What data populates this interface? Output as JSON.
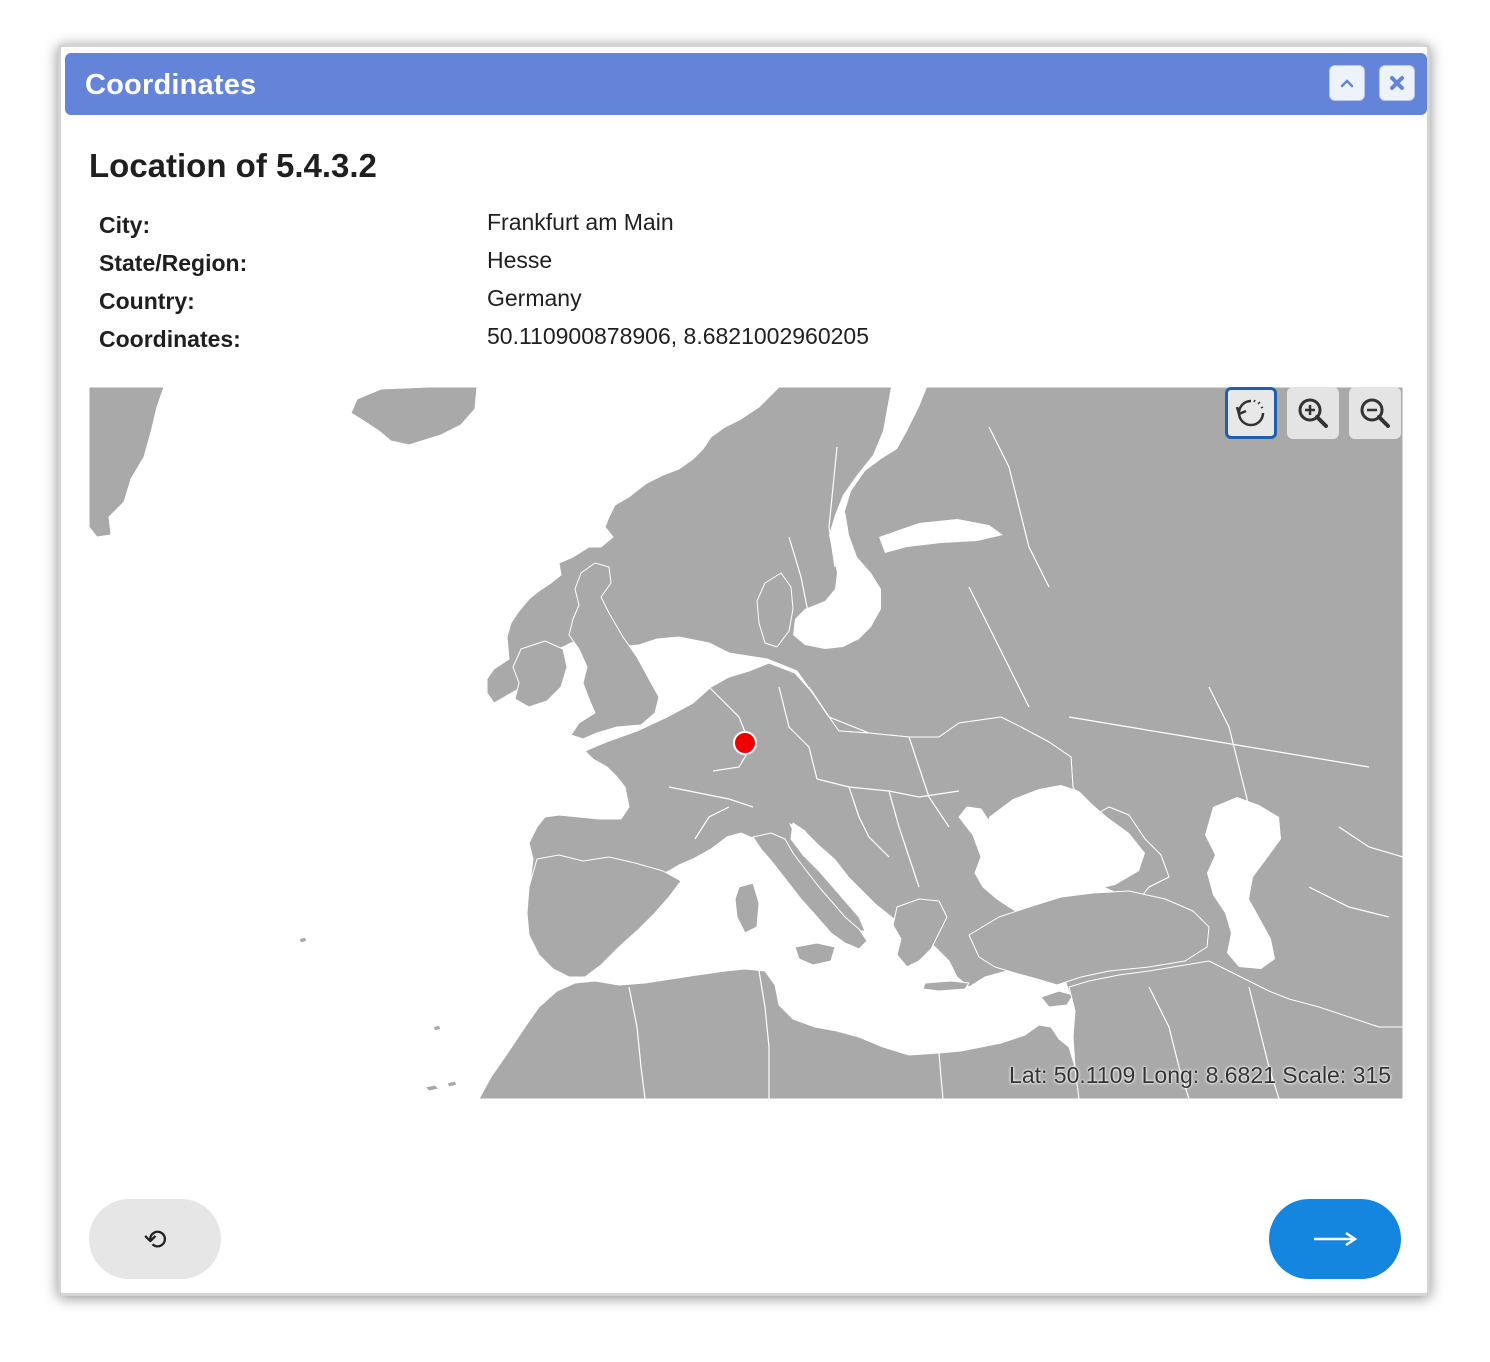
{
  "dialog": {
    "title": "Coordinates",
    "collapse_icon": "chevron-up-icon",
    "close_icon": "close-icon"
  },
  "location": {
    "heading": "Location of 5.4.3.2",
    "rows": [
      {
        "label": "City:",
        "value": "Frankfurt am Main"
      },
      {
        "label": "State/Region:",
        "value": "Hesse"
      },
      {
        "label": "Country:",
        "value": "Germany"
      },
      {
        "label": "Coordinates:",
        "value": "50.110900878906, 8.6821002960205"
      }
    ]
  },
  "map": {
    "status": "Lat: 50.1109 Long: 8.6821 Scale: 315",
    "land_color": "#a9a9a9",
    "water_color": "#ffffff",
    "marker_color": "#ee0000",
    "controls": {
      "reset_icon": "rotate-reset-icon",
      "zoom_in_icon": "zoom-in-icon",
      "zoom_out_icon": "zoom-out-icon"
    }
  },
  "footer": {
    "reset_label": "⟲",
    "next_label": "⟶",
    "accent": "#1486e0"
  }
}
